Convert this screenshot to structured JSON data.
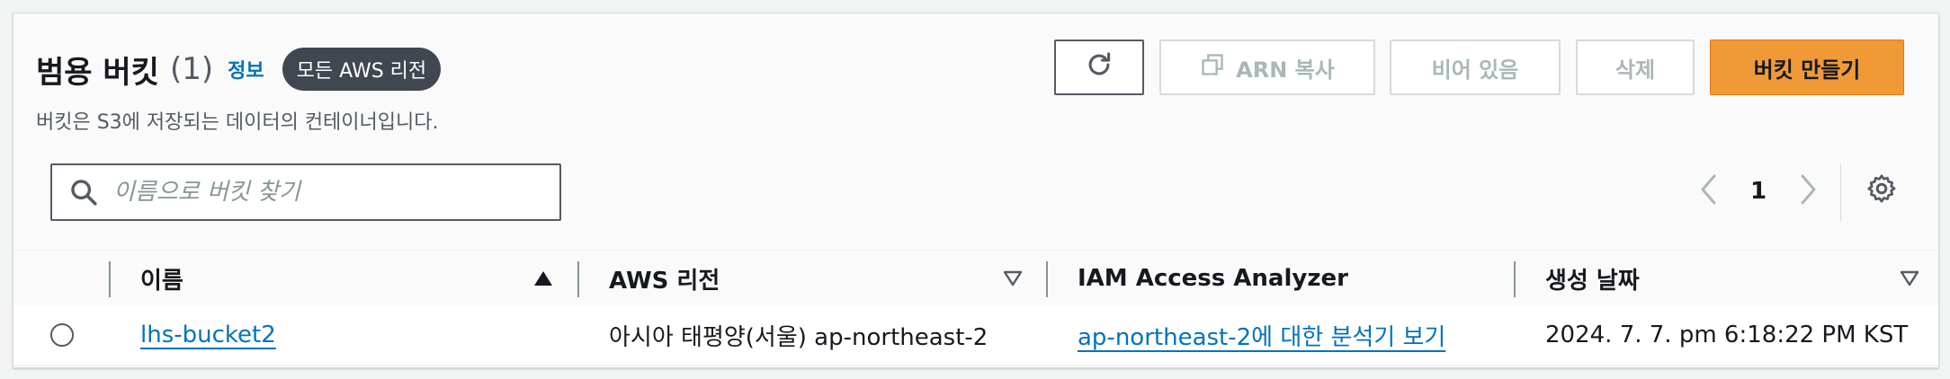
{
  "header": {
    "title": "범용 버킷",
    "count": "(1)",
    "info_link": "정보",
    "region_pill": "모든 AWS 리전",
    "subtitle": "버킷은 S3에 저장되는 데이터의 컨테이너입니다."
  },
  "toolbar": {
    "refresh_icon": "refresh-icon",
    "copy_arn_label": "ARN 복사",
    "copy_icon": "copy-icon",
    "empty_label": "비어 있음",
    "delete_label": "삭제",
    "create_label": "버킷 만들기"
  },
  "search": {
    "placeholder": "이름으로 버킷 찾기",
    "value": ""
  },
  "pagination": {
    "current_page": "1"
  },
  "table": {
    "columns": [
      "이름",
      "AWS 리전",
      "IAM Access Analyzer",
      "생성 날짜"
    ],
    "rows": [
      {
        "name": "lhs-bucket2",
        "region": "아시아 태평양(서울) ap-northeast-2",
        "analyzer": "ap-northeast-2에 대한 분석기 보기",
        "created": "2024. 7. 7. pm 6:18:22 PM KST"
      }
    ]
  },
  "colors": {
    "primary_button": "#f09a37",
    "link": "#0073bb",
    "pill_bg": "#414750"
  }
}
